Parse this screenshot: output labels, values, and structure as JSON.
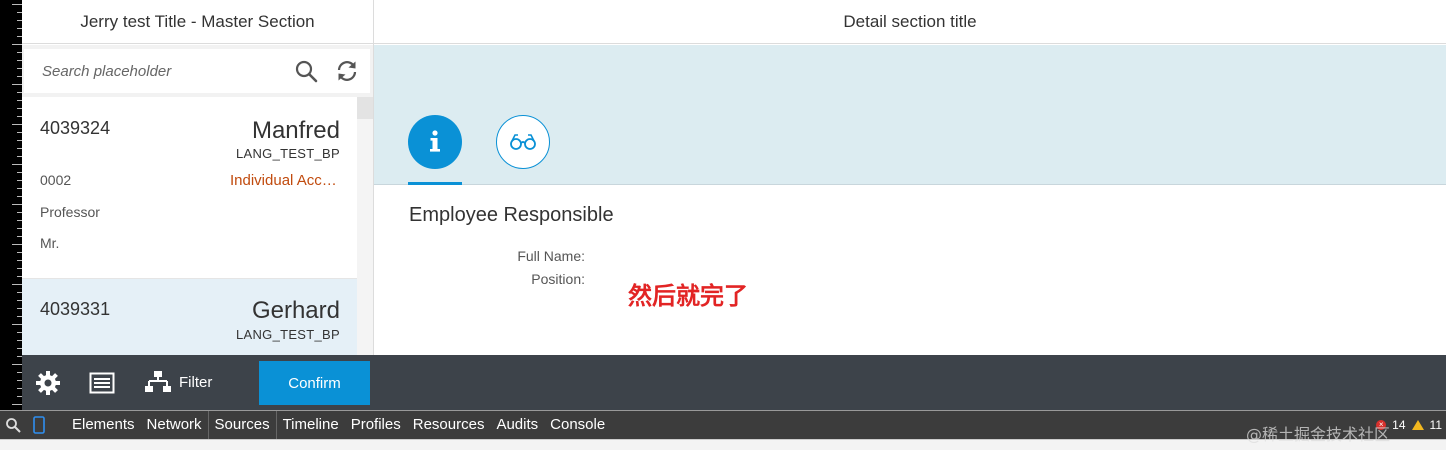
{
  "master": {
    "title": "Jerry test Title - Master Section",
    "search": {
      "placeholder": "Search placeholder",
      "value": ""
    },
    "items": [
      {
        "number": "4039324",
        "name": "Manfred",
        "subtitle": "LANG_TEST_BP",
        "attr1": "0002",
        "status": "Individual Account",
        "attr2": "Professor",
        "attr3": "Mr.",
        "selected": false
      },
      {
        "number": "4039331",
        "name": "Gerhard",
        "subtitle": "LANG_TEST_BP",
        "selected": true
      }
    ]
  },
  "detail": {
    "title": "Detail section title",
    "tabs": [
      {
        "icon": "info-icon",
        "selected": true
      },
      {
        "icon": "glasses-icon",
        "selected": false
      }
    ],
    "section_title": "Employee Responsible",
    "form": {
      "full_name_label": "Full Name:",
      "position_label": "Position:"
    },
    "annotation": "然后就完了"
  },
  "footer": {
    "filter_label": "Filter",
    "confirm_label": "Confirm"
  },
  "devtools": {
    "tabs": [
      "Elements",
      "Network",
      "Sources",
      "Timeline",
      "Profiles",
      "Resources",
      "Audits",
      "Console"
    ],
    "errors": "14",
    "warnings": "11"
  },
  "watermark": "@稀土掘金技术社区",
  "colors": {
    "accent": "#0a91d6",
    "status_text": "#c14b0e",
    "annotation": "#e22424",
    "footer_bg": "#3d434a",
    "tabbar_bg": "#dcecf1",
    "selected_item_bg": "#e5f0f7"
  }
}
